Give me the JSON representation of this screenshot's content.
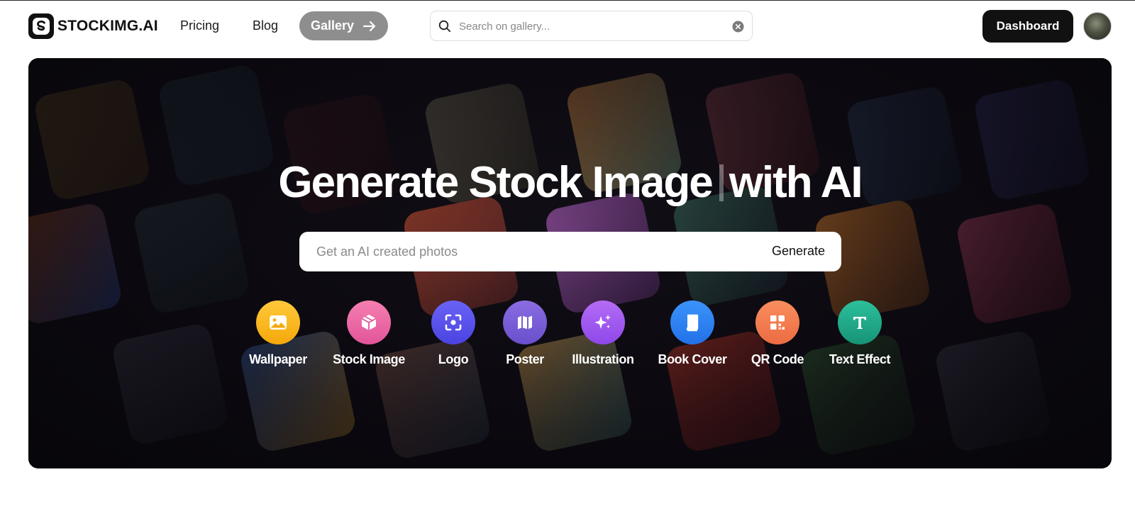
{
  "header": {
    "brand": "STOCKIMG.AI",
    "nav": {
      "pricing": "Pricing",
      "blog": "Blog",
      "gallery": "Gallery"
    },
    "search": {
      "placeholder": "Search on gallery...",
      "value": ""
    },
    "dashboard": "Dashboard"
  },
  "hero": {
    "title_part1": "Generate Stock Image",
    "title_part2": "with AI",
    "prompt": {
      "placeholder": "Get an AI created photos",
      "button": "Generate"
    },
    "categories": [
      {
        "label": "Wallpaper",
        "icon": "image-icon",
        "color": "#F7C21B"
      },
      {
        "label": "Stock Image",
        "icon": "cube-icon",
        "color": "#EE6CA4"
      },
      {
        "label": "Logo",
        "icon": "scan-focus-icon",
        "color": "#5B53F0"
      },
      {
        "label": "Poster",
        "icon": "map-icon",
        "color": "#7A5DD8"
      },
      {
        "label": "Illustration",
        "icon": "sparkles-icon",
        "color": "#A25BF2"
      },
      {
        "label": "Book Cover",
        "icon": "book-icon",
        "color": "#2F84F6"
      },
      {
        "label": "QR Code",
        "icon": "qr-code-icon",
        "color": "#F47C50"
      },
      {
        "label": "Text Effect",
        "icon": "letter-t-icon",
        "color": "#1FA889"
      }
    ]
  }
}
